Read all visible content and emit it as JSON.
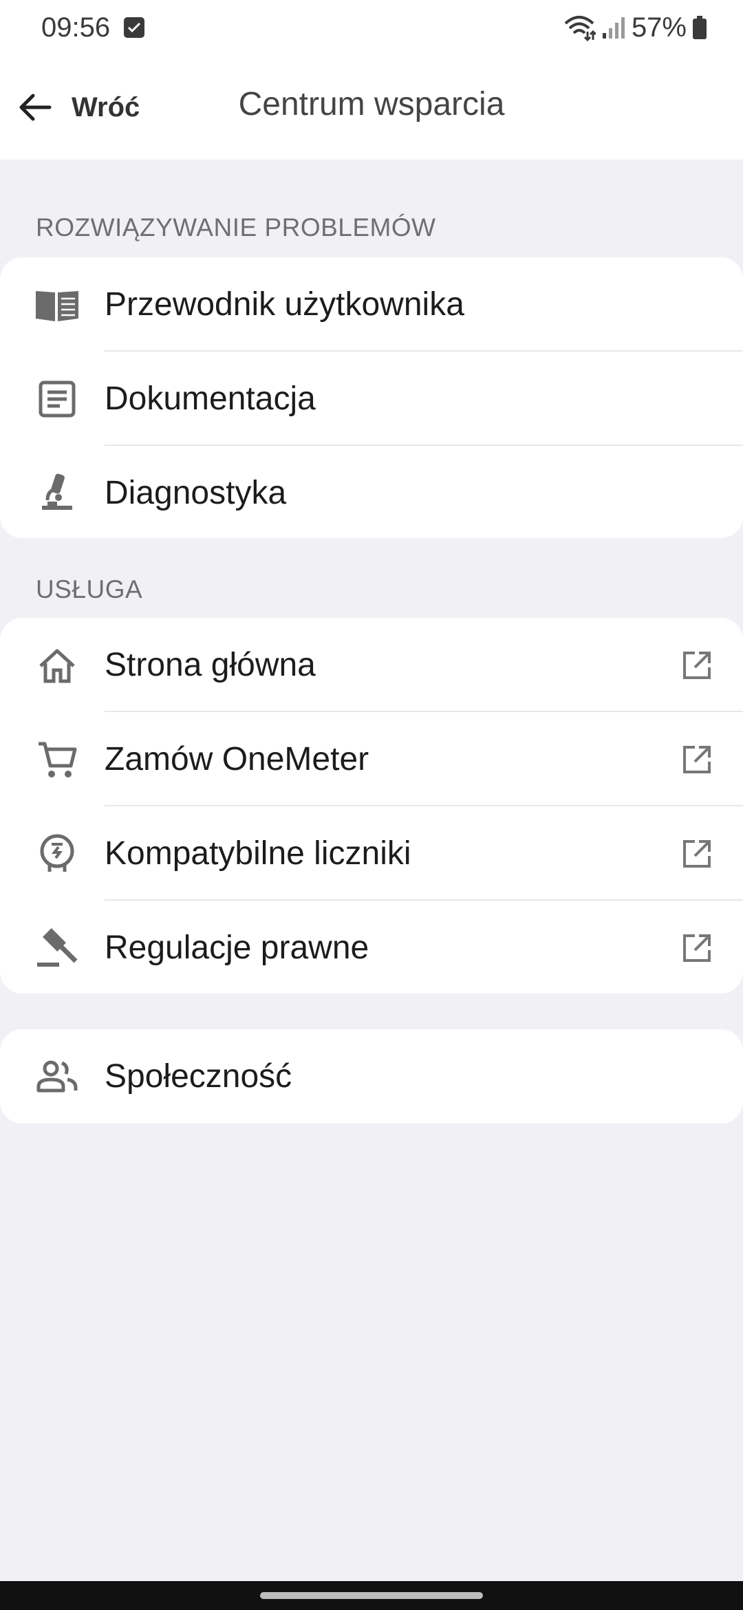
{
  "status": {
    "time": "09:56",
    "battery": "57%"
  },
  "header": {
    "back_label": "Wróć",
    "title": "Centrum wsparcia"
  },
  "sections": [
    {
      "title": "ROZWIĄZYWANIE PROBLEMÓW",
      "items": [
        {
          "label": "Przewodnik użytkownika",
          "icon": "book-icon"
        },
        {
          "label": "Dokumentacja",
          "icon": "document-icon"
        },
        {
          "label": "Diagnostyka",
          "icon": "microscope-icon"
        }
      ]
    },
    {
      "title": "USŁUGA",
      "items": [
        {
          "label": "Strona główna",
          "icon": "home-icon",
          "external": true
        },
        {
          "label": "Zamów OneMeter",
          "icon": "cart-icon",
          "external": true
        },
        {
          "label": "Kompatybilne liczniki",
          "icon": "meter-icon",
          "external": true
        },
        {
          "label": "Regulacje prawne",
          "icon": "gavel-icon",
          "external": true
        }
      ]
    },
    {
      "title": "",
      "items": [
        {
          "label": "Społeczność",
          "icon": "people-icon"
        }
      ]
    }
  ],
  "colors": {
    "background": "#f0f0f5",
    "card": "#ffffff",
    "icon": "#6b6b6b",
    "section_title": "#6e6e73"
  }
}
